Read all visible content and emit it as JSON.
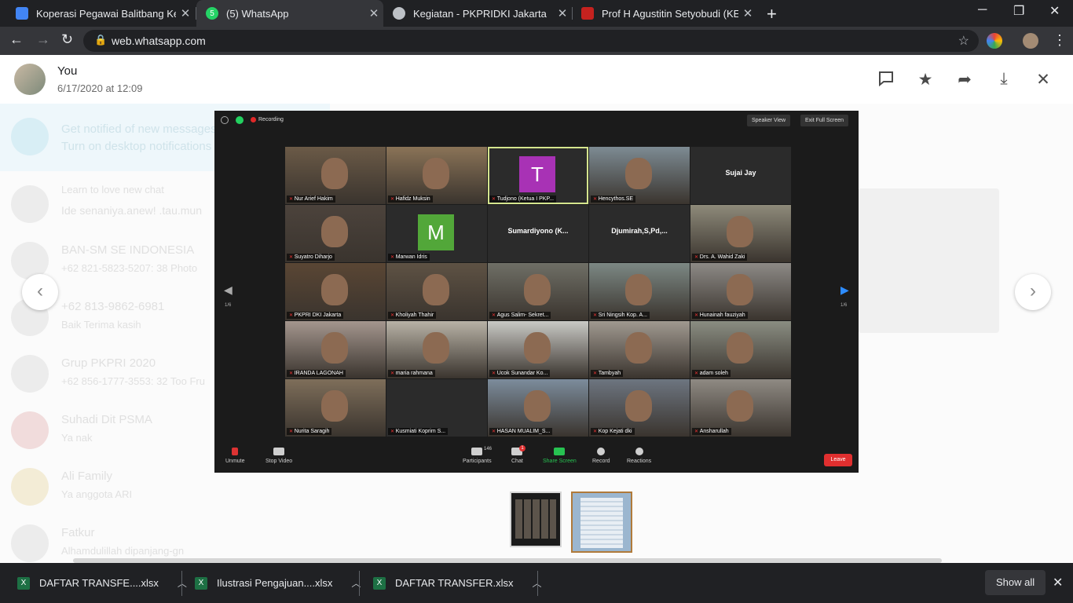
{
  "tabs": [
    {
      "title": "Koperasi Pegawai Balitbang Keme",
      "active": false,
      "favicon": "document-icon",
      "color": "#4285f4"
    },
    {
      "title": "(5) WhatsApp",
      "active": true,
      "favicon": "whatsapp-icon",
      "color": "#25d366"
    },
    {
      "title": "Kegiatan - PKPRIDKI Jakarta",
      "active": false,
      "favicon": "globe-icon",
      "color": "#bdc1c6"
    },
    {
      "title": "Prof H Agustitin Setyobudi (KETU",
      "active": false,
      "favicon": "bookmark-icon",
      "color": "#c5221f"
    }
  ],
  "address": {
    "url": "web.whatsapp.com"
  },
  "viewer": {
    "sender": "You",
    "timestamp": "6/17/2020 at 12:09"
  },
  "zoom": {
    "recording": "Recording",
    "speaker_view": "Speaker View",
    "exit_full": "Exit Full Screen",
    "page_left": "1/6",
    "page_right": "1/6",
    "participants_count": "146",
    "chat_badge": "1",
    "controls": [
      "Unmute",
      "Stop Video",
      "Participants",
      "Chat",
      "Share Screen",
      "Record",
      "Reactions"
    ],
    "leave": "Leave",
    "tiles": [
      {
        "name": "Nur Arief Hakim",
        "kind": "video",
        "bg": "#6b5a47"
      },
      {
        "name": "Hafidz Muksin",
        "kind": "video",
        "bg": "#8a7357"
      },
      {
        "name": "Tudjono (Ketua I PKP...",
        "kind": "letter",
        "letter": "T",
        "letter_color": "#a832b5",
        "highlight": true
      },
      {
        "name": "Hencythos.SE",
        "kind": "video",
        "bg": "#7d8b93"
      },
      {
        "name": "Sujai Jay",
        "kind": "name"
      },
      {
        "name": "Suyatro Diharjo",
        "kind": "video",
        "bg": "#4c433c"
      },
      {
        "name": "Marwan Idris",
        "kind": "letter",
        "letter": "M",
        "letter_color": "#52a739"
      },
      {
        "name": "Sumardiyono  (K...",
        "kind": "name"
      },
      {
        "name": "Djumirah,S,Pd,...",
        "kind": "name"
      },
      {
        "name": "Drs. A. Wahid Zaki",
        "kind": "video",
        "bg": "#8e8a7a"
      },
      {
        "name": "PKPRI DKI Jakarta",
        "kind": "video",
        "bg": "#5a4634"
      },
      {
        "name": "Kholiyah Thahir",
        "kind": "video",
        "bg": "#5e5244"
      },
      {
        "name": "Agus Salim- Sekret...",
        "kind": "video",
        "bg": "#6f6f66"
      },
      {
        "name": "Sri Ningsih Kop. A...",
        "kind": "video",
        "bg": "#7c8884"
      },
      {
        "name": "Hunainah fauziyah",
        "kind": "video",
        "bg": "#8d8a86"
      },
      {
        "name": "IRANDA LAGONAH",
        "kind": "video",
        "bg": "#a4968e"
      },
      {
        "name": "maria rahmana",
        "kind": "video",
        "bg": "#b8b2a6"
      },
      {
        "name": "Ucok Sunandar Ko...",
        "kind": "video",
        "bg": "#c9c9c5"
      },
      {
        "name": "Tambyah",
        "kind": "video",
        "bg": "#a09990"
      },
      {
        "name": "adam soleh",
        "kind": "video",
        "bg": "#8a8d82"
      },
      {
        "name": "Nurita Saragih",
        "kind": "video",
        "bg": "#7e6e5a"
      },
      {
        "name": "Kusmiati Koprim S...",
        "kind": "blank"
      },
      {
        "name": "HASAN MUALIM_S...",
        "kind": "video",
        "bg": "#7c8c9c"
      },
      {
        "name": "Kop Kejati dki",
        "kind": "video",
        "bg": "#6d7580"
      },
      {
        "name": "Ansharullah",
        "kind": "video",
        "bg": "#8f8a83"
      }
    ]
  },
  "background_chats": [
    {
      "title": "Get notified of new messages",
      "sub": "Turn on desktop notifications"
    },
    {
      "title": "Learn to love new chat",
      "sub": "Ide senaniya.anew! .tau.mun"
    },
    {
      "title": "BAN-SM SE INDONESIA",
      "sub": "+62 821-5823-5207: 38 Photo"
    },
    {
      "title": "+62 813-9862-6981",
      "sub": "Baik Terima kasih"
    },
    {
      "title": "Grup PKPRI 2020",
      "sub": "+62 856-1777-3553: 32 Too Fru"
    },
    {
      "title": "Suhadi Dit PSMA",
      "sub": "Ya nak"
    },
    {
      "title": "Ali Family",
      "sub": "Ya anggota ARI"
    },
    {
      "title": "Fatkur",
      "sub": "Alhamdulillah dipanjang-gn"
    }
  ],
  "downloads": [
    {
      "name": "DAFTAR TRANSFE....xlsx"
    },
    {
      "name": "Ilustrasi Pengajuan....xlsx"
    },
    {
      "name": "DAFTAR TRANSFER.xlsx"
    }
  ],
  "download_bar": {
    "show_all": "Show all"
  }
}
